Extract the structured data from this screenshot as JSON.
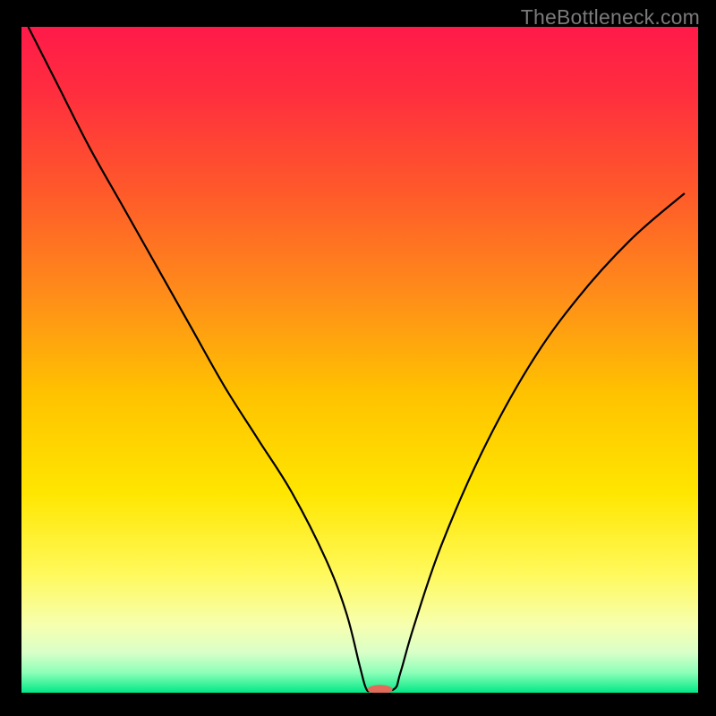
{
  "watermark": "TheBottleneck.com",
  "chart_data": {
    "type": "line",
    "title": "",
    "xlabel": "",
    "ylabel": "",
    "xlim": [
      0,
      100
    ],
    "ylim": [
      0,
      100
    ],
    "background_gradient": {
      "stops": [
        {
          "offset": 0.0,
          "color": "#ff1a4a"
        },
        {
          "offset": 0.1,
          "color": "#ff2e3e"
        },
        {
          "offset": 0.25,
          "color": "#ff5a2a"
        },
        {
          "offset": 0.4,
          "color": "#ff8c1a"
        },
        {
          "offset": 0.55,
          "color": "#ffc200"
        },
        {
          "offset": 0.7,
          "color": "#ffe600"
        },
        {
          "offset": 0.82,
          "color": "#fff95a"
        },
        {
          "offset": 0.9,
          "color": "#f6ffb0"
        },
        {
          "offset": 0.94,
          "color": "#d8ffc8"
        },
        {
          "offset": 0.97,
          "color": "#8cffb8"
        },
        {
          "offset": 1.0,
          "color": "#00e886"
        }
      ]
    },
    "series": [
      {
        "name": "bottleneck-curve",
        "color": "#000000",
        "x": [
          1,
          5,
          10,
          15,
          20,
          25,
          30,
          35,
          40,
          45,
          48,
          50,
          51,
          52,
          55,
          56,
          58,
          62,
          68,
          75,
          82,
          90,
          98
        ],
        "values": [
          100,
          92,
          82,
          73,
          64,
          55,
          46,
          38,
          30,
          20,
          12,
          4,
          0.5,
          0.5,
          0.5,
          3,
          10,
          22,
          36,
          49,
          59,
          68,
          75
        ]
      }
    ],
    "marker": {
      "name": "min-point",
      "x": 53,
      "y": 0.5,
      "color": "#e26a5a",
      "rx": 14,
      "ry": 5
    }
  }
}
